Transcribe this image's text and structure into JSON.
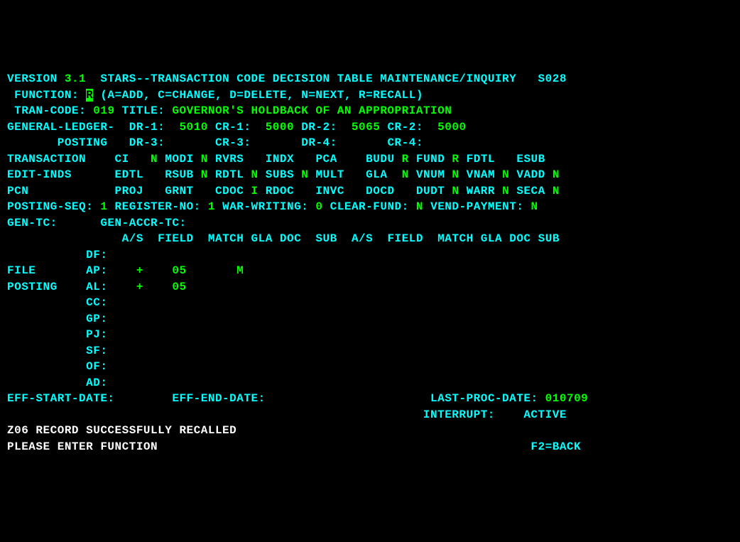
{
  "header": {
    "version_lbl": "VERSION",
    "version": "3.1",
    "title": "STARS--TRANSACTION CODE DECISION TABLE MAINTENANCE/INQUIRY",
    "screen_id": "S028"
  },
  "function": {
    "label": "FUNCTION:",
    "value": "R",
    "hint": "(A=ADD, C=CHANGE, D=DELETE, N=NEXT, R=RECALL)"
  },
  "tran": {
    "label": "TRAN-CODE:",
    "code": "019",
    "title_lbl": "TITLE:",
    "title": "GOVERNOR'S HOLDBACK OF AN APPROPRIATION"
  },
  "gl": {
    "label": "GENERAL-LEDGER-",
    "dr1_lbl": "DR-1:",
    "dr1": "5010",
    "cr1_lbl": "CR-1:",
    "cr1": "5000",
    "dr2_lbl": "DR-2:",
    "dr2": "5065",
    "cr2_lbl": "CR-2:",
    "cr2": "5000",
    "posting_lbl": "POSTING",
    "dr3_lbl": "DR-3:",
    "cr3_lbl": "CR-3:",
    "dr4_lbl": "DR-4:",
    "cr4_lbl": "CR-4:"
  },
  "row1": {
    "transaction": "TRANSACTION",
    "ci": "CI",
    "ci_v": "N",
    "modi": "MODI",
    "modi_v": "N",
    "rvrs": "RVRS",
    "indx": "INDX",
    "pca": "PCA",
    "budu": "BUDU",
    "budu_v": "R",
    "fund": "FUND",
    "fund_v": "R",
    "fdtl": "FDTL",
    "esub": "ESUB"
  },
  "row2": {
    "editinds": "EDIT-INDS",
    "edtl": "EDTL",
    "rsub": "RSUB",
    "rsub_v": "N",
    "rdtl": "RDTL",
    "rdtl_v": "N",
    "subs": "SUBS",
    "subs_v": "N",
    "mult": "MULT",
    "gla": "GLA",
    "gla_v": "N",
    "vnum": "VNUM",
    "vnum_v": "N",
    "vnam": "VNAM",
    "vnam_v": "N",
    "vadd": "VADD",
    "vadd_v": "N"
  },
  "row3": {
    "pcn": "PCN",
    "proj": "PROJ",
    "grnt": "GRNT",
    "cdoc": "CDOC",
    "cdoc_v": "I",
    "rdoc": "RDOC",
    "invc": "INVC",
    "docd": "DOCD",
    "dudt": "DUDT",
    "dudt_v": "N",
    "warr": "WARR",
    "warr_v": "N",
    "seca": "SECA",
    "seca_v": "N"
  },
  "row4": {
    "seq_lbl": "POSTING-SEQ:",
    "seq": "1",
    "reg_lbl": "REGISTER-NO:",
    "reg": "1",
    "war_lbl": "WAR-WRITING:",
    "war": "0",
    "cf_lbl": "CLEAR-FUND:",
    "cf": "N",
    "vp_lbl": "VEND-PAYMENT:",
    "vp": "N"
  },
  "row5": {
    "gentc": "GEN-TC:",
    "genaccr": "GEN-ACCR-TC:"
  },
  "cols": {
    "as": "A/S",
    "field": "FIELD",
    "match": "MATCH",
    "gla": "GLA",
    "doc": "DOC",
    "sub": "SUB"
  },
  "files": {
    "df": "DF:",
    "ap": "AP:",
    "al": "AL:",
    "cc": "CC:",
    "gp": "GP:",
    "pj": "PJ:",
    "sf": "SF:",
    "of": "OF:",
    "ad": "AD:",
    "file_lbl": "FILE",
    "posting_lbl": "POSTING",
    "ap_as": "+",
    "ap_field": "05",
    "ap_match": "M",
    "al_as": "+",
    "al_field": "05"
  },
  "dates": {
    "eff_start": "EFF-START-DATE:",
    "eff_end": "EFF-END-DATE:",
    "last_proc_lbl": "LAST-PROC-DATE:",
    "last_proc": "010709",
    "interrupt_lbl": "INTERRUPT:",
    "interrupt": "ACTIVE"
  },
  "status": {
    "msg1": "Z06 RECORD SUCCESSFULLY RECALLED",
    "msg2": "PLEASE ENTER FUNCTION",
    "back": "F2=BACK"
  }
}
